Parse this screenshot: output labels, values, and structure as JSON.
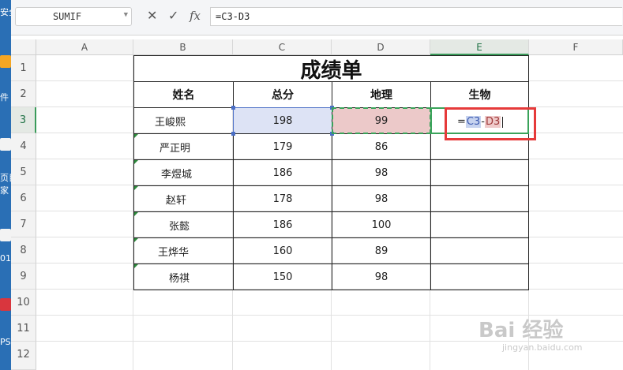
{
  "formula_bar": {
    "name_box": "SUMIF",
    "cancel_icon": "cancel-x-icon",
    "confirm_icon": "checkmark-icon",
    "fx_label": "fx",
    "formula": "=C3-D3"
  },
  "columns": [
    "A",
    "B",
    "C",
    "D",
    "E",
    "F"
  ],
  "rows": [
    "1",
    "2",
    "3",
    "4",
    "5",
    "6",
    "7",
    "8",
    "9",
    "10",
    "11",
    "12"
  ],
  "sheet": {
    "title": "成绩单",
    "headers": [
      "姓名",
      "总分",
      "地理",
      "生物"
    ],
    "records": [
      {
        "name": "王峻熙",
        "total": "198",
        "geo": "99"
      },
      {
        "name": "严正明",
        "total": "179",
        "geo": "86"
      },
      {
        "name": "李煜城",
        "total": "186",
        "geo": "98"
      },
      {
        "name": "赵轩",
        "total": "178",
        "geo": "98"
      },
      {
        "name": "张懿",
        "total": "186",
        "geo": "100"
      },
      {
        "name": "王烨华",
        "total": "160",
        "geo": "89"
      },
      {
        "name": "杨祺",
        "total": "150",
        "geo": "98"
      }
    ]
  },
  "editing": {
    "eq": "=",
    "ref1": "C3",
    "op": "-",
    "ref2": "D3"
  },
  "desktop_strip": [
    "安全",
    "件丨",
    "页目",
    "家",
    "01",
    "PS"
  ],
  "watermark": {
    "main": "Bai 经验",
    "sub": "jingyan.baidu.com"
  },
  "colors": {
    "accent_green": "#3aa35a",
    "highlight_box": "#e63a3a",
    "ref_blue": "#c7d3ef",
    "ref_red": "#efcaca"
  }
}
